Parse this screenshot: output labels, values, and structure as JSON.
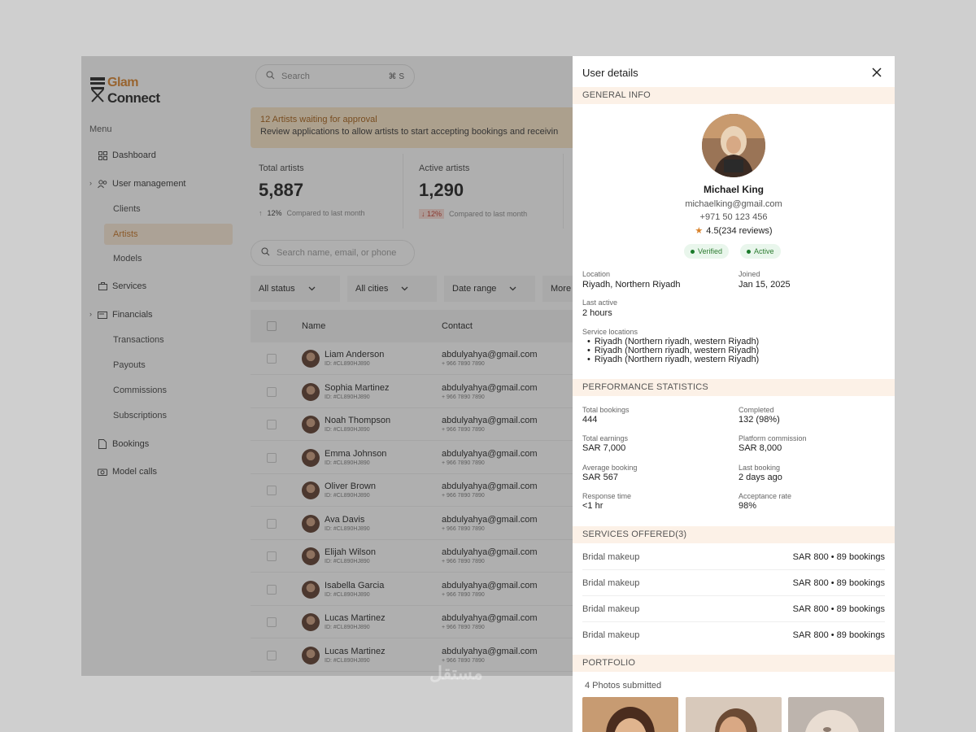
{
  "brand": {
    "line1": "Glam",
    "line2": "Connect"
  },
  "sidebar": {
    "menu_title": "Menu",
    "items": {
      "dashboard": "Dashboard",
      "user_management": "User management",
      "clients": "Clients",
      "artists": "Artists",
      "models": "Models",
      "services": "Services",
      "financials": "Financials",
      "transactions": "Transactions",
      "payouts": "Payouts",
      "commissions": "Commissions",
      "subscriptions": "Subscriptions",
      "bookings": "Bookings",
      "model_calls": "Model calls"
    }
  },
  "topbar": {
    "search_placeholder": "Search",
    "shortcut": "⌘ S"
  },
  "banner": {
    "title": "12 Artists waiting for approval",
    "text": "Review applications to allow artists to start accepting bookings and receivin"
  },
  "stats": [
    {
      "title": "Total artists",
      "value": "5,887",
      "pct": "12%",
      "note": "Compared to last month",
      "trend": "up"
    },
    {
      "title": "Active artists",
      "value": "1,290",
      "pct": "12%",
      "note": "Compared to last month",
      "trend": "down"
    }
  ],
  "table_search_placeholder": "Search name, email, or phone",
  "filters": {
    "status": "All status",
    "cities": "All cities",
    "date": "Date  range",
    "more": "More"
  },
  "table": {
    "headers": {
      "name": "Name",
      "contact": "Contact"
    },
    "rows": [
      {
        "name": "Liam Anderson",
        "id": "ID: #CL890HJ890",
        "email": "abdulyahya@gmail.com",
        "phone": "+ 966 7890 7890"
      },
      {
        "name": "Sophia Martinez",
        "id": "ID: #CL890HJ890",
        "email": "abdulyahya@gmail.com",
        "phone": "+ 966 7890 7890"
      },
      {
        "name": "Noah Thompson",
        "id": "ID: #CL890HJ890",
        "email": "abdulyahya@gmail.com",
        "phone": "+ 966 7890 7890"
      },
      {
        "name": "Emma Johnson",
        "id": "ID: #CL890HJ890",
        "email": "abdulyahya@gmail.com",
        "phone": "+ 966 7890 7890"
      },
      {
        "name": "Oliver Brown",
        "id": "ID: #CL890HJ890",
        "email": "abdulyahya@gmail.com",
        "phone": "+ 966 7890 7890"
      },
      {
        "name": "Ava Davis",
        "id": "ID: #CL890HJ890",
        "email": "abdulyahya@gmail.com",
        "phone": "+ 966 7890 7890"
      },
      {
        "name": "Elijah Wilson",
        "id": "ID: #CL890HJ890",
        "email": "abdulyahya@gmail.com",
        "phone": "+ 966 7890 7890"
      },
      {
        "name": "Isabella Garcia",
        "id": "ID: #CL890HJ890",
        "email": "abdulyahya@gmail.com",
        "phone": "+ 966 7890 7890"
      },
      {
        "name": "Lucas Martinez",
        "id": "ID: #CL890HJ890",
        "email": "abdulyahya@gmail.com",
        "phone": "+ 966 7890 7890"
      },
      {
        "name": "Lucas Martinez",
        "id": "ID: #CL890HJ890",
        "email": "abdulyahya@gmail.com",
        "phone": "+ 966 7890 7890"
      }
    ]
  },
  "drawer": {
    "title": "User details",
    "sections": {
      "general": "GENERAL INFO",
      "performance": "PERFORMANCE STATISTICS",
      "services": "SERVICES OFFERED(3)",
      "portfolio": "PORTFOLIO"
    },
    "user": {
      "name": "Michael King",
      "email": "michaelking@gmail.com",
      "phone": "+971 50 123 456",
      "rating": "4.5(234 reviews)",
      "badges": {
        "verified": "Verified",
        "active": "Active"
      }
    },
    "general": {
      "location_label": "Location",
      "location": "Riyadh, Northern Riyadh",
      "joined_label": "Joined",
      "joined": "Jan 15, 2025",
      "last_active_label": "Last active",
      "last_active": "2 hours",
      "service_locations_label": "Service locations",
      "service_locations": [
        "Riyadh (Northern riyadh, western Riyadh)",
        "Riyadh (Northern riyadh, western Riyadh)",
        "Riyadh (Northern riyadh, western Riyadh)"
      ]
    },
    "performance": {
      "total_bookings_label": "Total bookings",
      "total_bookings": "444",
      "completed_label": "Completed",
      "completed": "132 (98%)",
      "total_earnings_label": "Total earnings",
      "total_earnings": "SAR 7,000",
      "platform_commission_label": "Platform commission",
      "platform_commission": "SAR 8,000",
      "average_booking_label": "Average booking",
      "average_booking": "SAR 567",
      "last_booking_label": "Last booking",
      "last_booking": "2 days ago",
      "response_time_label": "Response time",
      "response_time": "<1 hr",
      "acceptance_rate_label": "Acceptance rate",
      "acceptance_rate": "98%"
    },
    "services": [
      {
        "name": "Bridal makeup",
        "price": "SAR 800 • 89 bookings"
      },
      {
        "name": "Bridal makeup",
        "price": "SAR 800 • 89 bookings"
      },
      {
        "name": "Bridal makeup",
        "price": "SAR 800 • 89 bookings"
      },
      {
        "name": "Bridal makeup",
        "price": "SAR 800 • 89 bookings"
      }
    ],
    "portfolio": {
      "count": "4 Photos submitted"
    }
  },
  "watermark": "مستقل"
}
